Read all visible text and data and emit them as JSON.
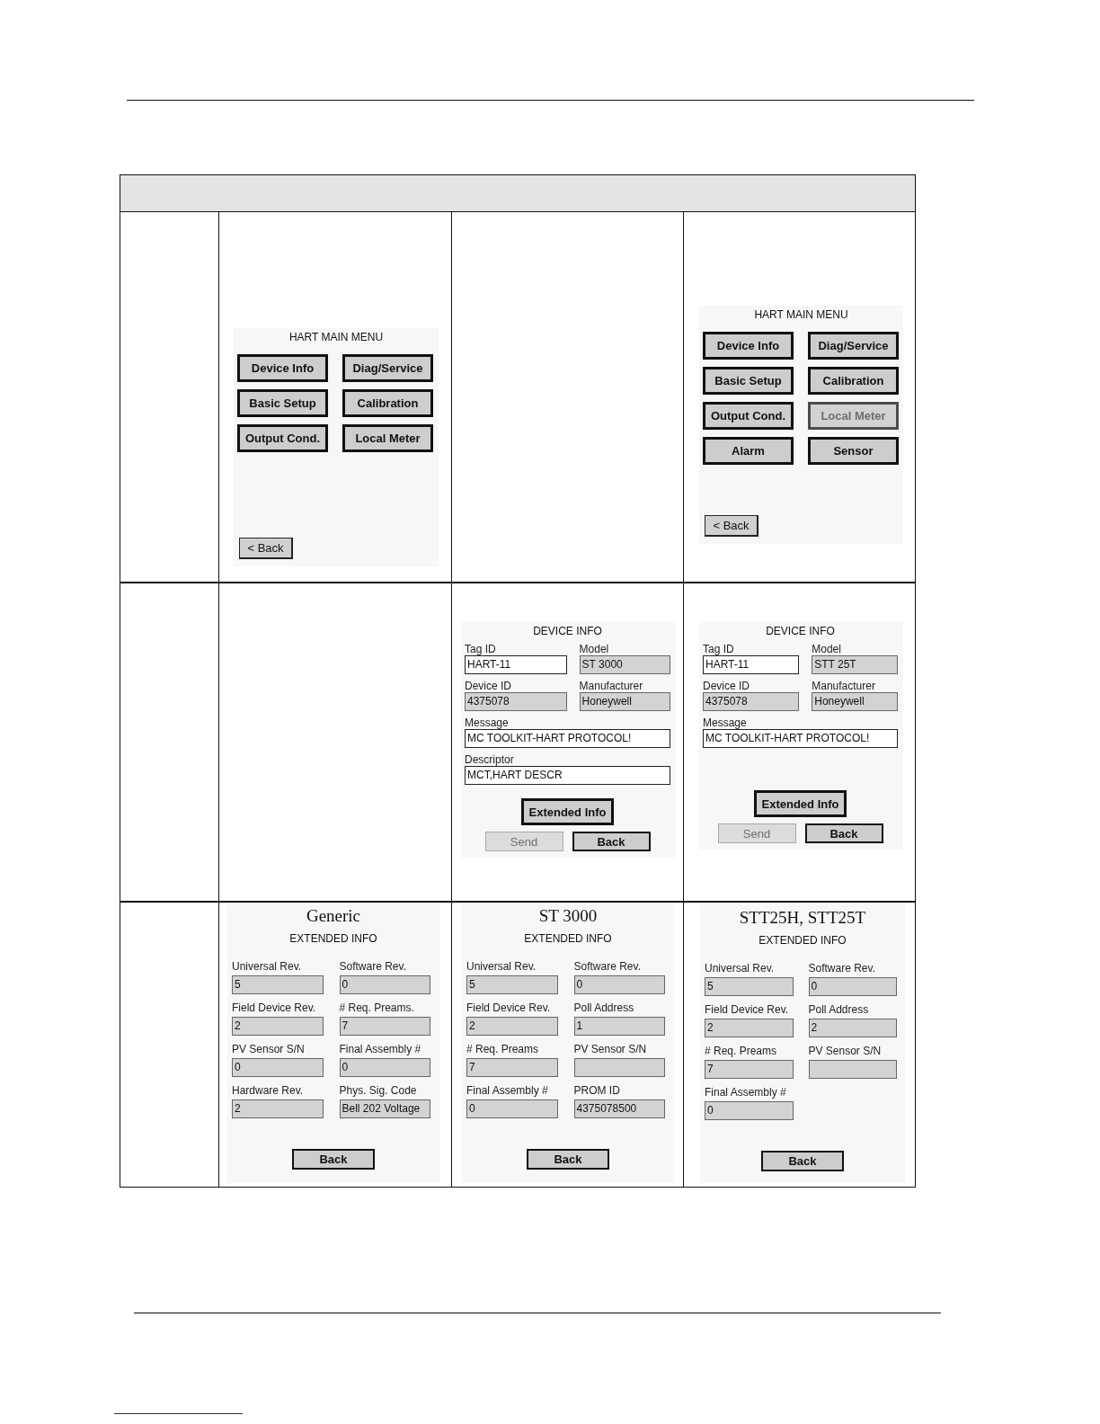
{
  "table": {
    "rows": [
      {
        "cells": [
          {
            "kind": "empty"
          },
          {
            "kind": "main_menu",
            "title": "HART MAIN MENU",
            "buttons": [
              {
                "label": "Device Info",
                "disabled": false
              },
              {
                "label": "Diag/Service",
                "disabled": false
              },
              {
                "label": "Basic Setup",
                "disabled": false
              },
              {
                "label": "Calibration",
                "disabled": false
              },
              {
                "label": "Output Cond.",
                "disabled": false
              },
              {
                "label": "Local Meter",
                "disabled": false
              }
            ],
            "back_button": {
              "label": "< Back"
            }
          },
          {
            "kind": "empty"
          },
          {
            "kind": "main_menu",
            "title": "HART MAIN MENU",
            "buttons": [
              {
                "label": "Device Info",
                "disabled": false
              },
              {
                "label": "Diag/Service",
                "disabled": false
              },
              {
                "label": "Basic Setup",
                "disabled": false
              },
              {
                "label": "Calibration",
                "disabled": false
              },
              {
                "label": "Output Cond.",
                "disabled": false
              },
              {
                "label": "Local Meter",
                "disabled": true
              },
              {
                "label": "Alarm",
                "disabled": false
              },
              {
                "label": "Sensor",
                "disabled": false
              }
            ],
            "back_button": {
              "label": "< Back"
            }
          }
        ]
      },
      {
        "cells": [
          {
            "kind": "empty"
          },
          {
            "kind": "empty"
          },
          {
            "kind": "device_info",
            "title": "DEVICE INFO",
            "fields": [
              {
                "kind": "half",
                "label": "Tag ID",
                "value": "HART-11",
                "editable": true
              },
              {
                "kind": "half",
                "label": "Model",
                "value": "ST 3000",
                "editable": false
              },
              {
                "kind": "half",
                "label": "Device ID",
                "value": "4375078",
                "editable": false
              },
              {
                "kind": "half",
                "label": "Manufacturer",
                "value": "Honeywell",
                "editable": false
              },
              {
                "kind": "full",
                "label": "Message",
                "value": "MC TOOLKIT-HART PROTOCOL!",
                "editable": true
              },
              {
                "kind": "full",
                "label": "Descriptor",
                "value": "MCT,HART DESCR",
                "editable": true
              }
            ],
            "extended_button": {
              "label": "Extended Info"
            },
            "buttons": [
              {
                "label": "Send",
                "disabled": true
              },
              {
                "label": "Back",
                "disabled": false
              }
            ]
          },
          {
            "kind": "device_info",
            "title": "DEVICE INFO",
            "fields": [
              {
                "kind": "half",
                "label": "Tag ID",
                "value": "HART-11",
                "editable": true
              },
              {
                "kind": "half",
                "label": "Model",
                "value": "STT 25T",
                "editable": false
              },
              {
                "kind": "half",
                "label": "Device ID",
                "value": "4375078",
                "editable": false
              },
              {
                "kind": "half",
                "label": "Manufacturer",
                "value": "Honeywell",
                "editable": false
              },
              {
                "kind": "full",
                "label": "Message",
                "value": "MC TOOLKIT-HART PROTOCOL!",
                "editable": true
              }
            ],
            "extended_button": {
              "label": "Extended Info"
            },
            "buttons": [
              {
                "label": "Send",
                "disabled": true
              },
              {
                "label": "Back",
                "disabled": false
              }
            ]
          }
        ]
      },
      {
        "cells": [
          {
            "kind": "empty"
          },
          {
            "kind": "extended_info",
            "heading": "Generic",
            "title": "EXTENDED INFO",
            "fields": [
              {
                "kind": "half",
                "label": "Universal Rev.",
                "value": "5",
                "editable": false
              },
              {
                "kind": "half",
                "label": "Software Rev.",
                "value": "0",
                "editable": false
              },
              {
                "kind": "half",
                "label": "Field Device Rev.",
                "value": "2",
                "editable": false
              },
              {
                "kind": "half",
                "label": "# Req. Preams.",
                "value": "7",
                "editable": false
              },
              {
                "kind": "half",
                "label": "PV Sensor S/N",
                "value": "0",
                "editable": false
              },
              {
                "kind": "half",
                "label": "Final Assembly #",
                "value": "0",
                "editable": false
              },
              {
                "kind": "half",
                "label": "Hardware Rev.",
                "value": "2",
                "editable": false
              },
              {
                "kind": "half",
                "label": "Phys. Sig. Code",
                "value": "Bell 202 Voltage",
                "editable": false
              }
            ],
            "back_button": {
              "label": "Back"
            }
          },
          {
            "kind": "extended_info",
            "heading": "ST 3000",
            "title": "EXTENDED INFO",
            "fields": [
              {
                "kind": "half",
                "label": "Universal Rev.",
                "value": "5",
                "editable": false
              },
              {
                "kind": "half",
                "label": "Software Rev.",
                "value": "0",
                "editable": false
              },
              {
                "kind": "half",
                "label": "Field Device Rev.",
                "value": "2",
                "editable": false
              },
              {
                "kind": "half",
                "label": "Poll Address",
                "value": "1",
                "editable": false
              },
              {
                "kind": "half",
                "label": "# Req. Preams",
                "value": "7",
                "editable": false
              },
              {
                "kind": "half",
                "label": "PV Sensor S/N",
                "editable": false
              },
              {
                "kind": "half",
                "label": "Final Assembly #",
                "value": "0",
                "editable": false
              },
              {
                "kind": "half",
                "label": "PROM ID",
                "value": "4375078500",
                "editable": false
              }
            ],
            "back_button": {
              "label": "Back"
            }
          },
          {
            "kind": "extended_info",
            "heading": "STT25H, STT25T",
            "title": "EXTENDED INFO",
            "fields": [
              {
                "kind": "half",
                "label": "Universal Rev.",
                "value": "5",
                "editable": false
              },
              {
                "kind": "half",
                "label": "Software Rev.",
                "value": "0",
                "editable": false
              },
              {
                "kind": "half",
                "label": "Field Device Rev.",
                "value": "2",
                "editable": false
              },
              {
                "kind": "half",
                "label": "Poll Address",
                "value": "2",
                "editable": false
              },
              {
                "kind": "half",
                "label": "# Req. Preams",
                "value": "7",
                "editable": false
              },
              {
                "kind": "half",
                "label": "PV Sensor S/N",
                "editable": false
              },
              {
                "kind": "half",
                "label": "Final Assembly #",
                "value": "0",
                "editable": false
              }
            ],
            "back_button": {
              "label": "Back"
            }
          }
        ]
      }
    ]
  }
}
